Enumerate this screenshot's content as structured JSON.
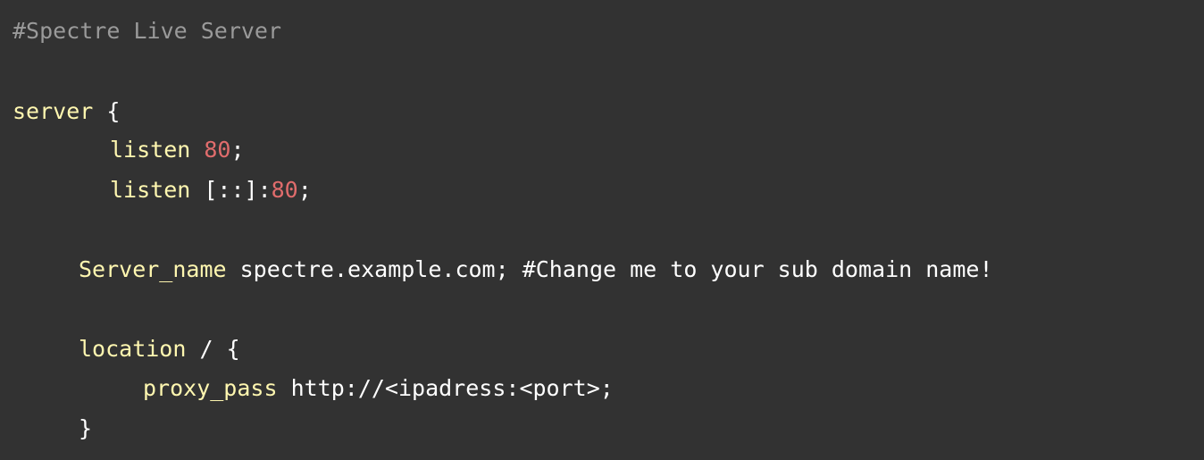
{
  "code": {
    "header_comment": "#Spectre Live Server",
    "server_kw": "server",
    "open_brace": " {",
    "listen_kw": "listen",
    "listen1_value": "80",
    "listen1_end": ";",
    "listen2_prefix": " [::]:",
    "listen2_value": "80",
    "listen2_end": ";",
    "server_name_kw": "Server_name",
    "server_name_rest": " spectre.example.com; #Change me to your sub domain name!",
    "location_kw": "location",
    "location_rest": " / {",
    "proxy_pass_kw": "proxy_pass",
    "proxy_pass_rest": " http://<ipadress:<port>;",
    "close_brace": "}"
  },
  "colors": {
    "background": "#323232",
    "keyword": "#fff7b0",
    "number": "#e06c6c",
    "comment": "#9a9a9a",
    "text": "#ffffff"
  }
}
